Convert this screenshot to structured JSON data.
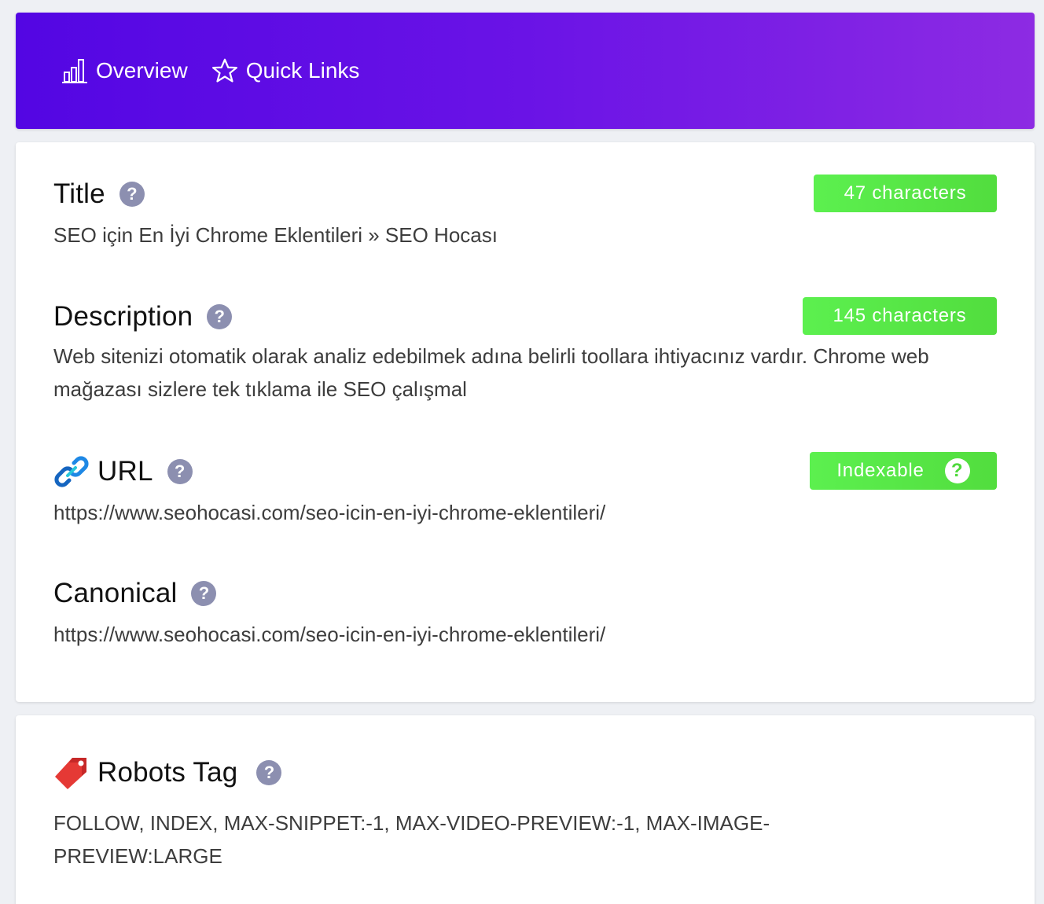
{
  "nav": {
    "overview_label": "Overview",
    "quick_links_label": "Quick Links"
  },
  "sections": {
    "title": {
      "heading": "Title",
      "badge": "47 characters",
      "value": "SEO için En İyi Chrome Eklentileri » SEO Hocası"
    },
    "description": {
      "heading": "Description",
      "badge": "145 characters",
      "value": "Web sitenizi otomatik olarak analiz edebilmek adına belirli toollara ihtiyacınız vardır. Chrome web mağazası sizlere tek tıklama ile SEO çalışmal"
    },
    "url": {
      "heading": "URL",
      "badge": "Indexable",
      "value": "https://www.seohocasi.com/seo-icin-en-iyi-chrome-eklentileri/"
    },
    "canonical": {
      "heading": "Canonical",
      "value": "https://www.seohocasi.com/seo-icin-en-iyi-chrome-eklentileri/"
    },
    "robots": {
      "heading": "Robots Tag",
      "value": "FOLLOW, INDEX, MAX-SNIPPET:-1, MAX-VIDEO-PREVIEW:-1, MAX-IMAGE-PREVIEW:LARGE"
    }
  },
  "help_glyph": "?",
  "icons": [
    "bar-chart-icon",
    "star-icon",
    "link-icon",
    "tag-icon",
    "help-icon"
  ],
  "colors": {
    "header_gradient_start": "#5306e3",
    "header_gradient_end": "#8d2be3",
    "badge_green": "#5cf04f",
    "help_icon": "#8c8fb0"
  }
}
